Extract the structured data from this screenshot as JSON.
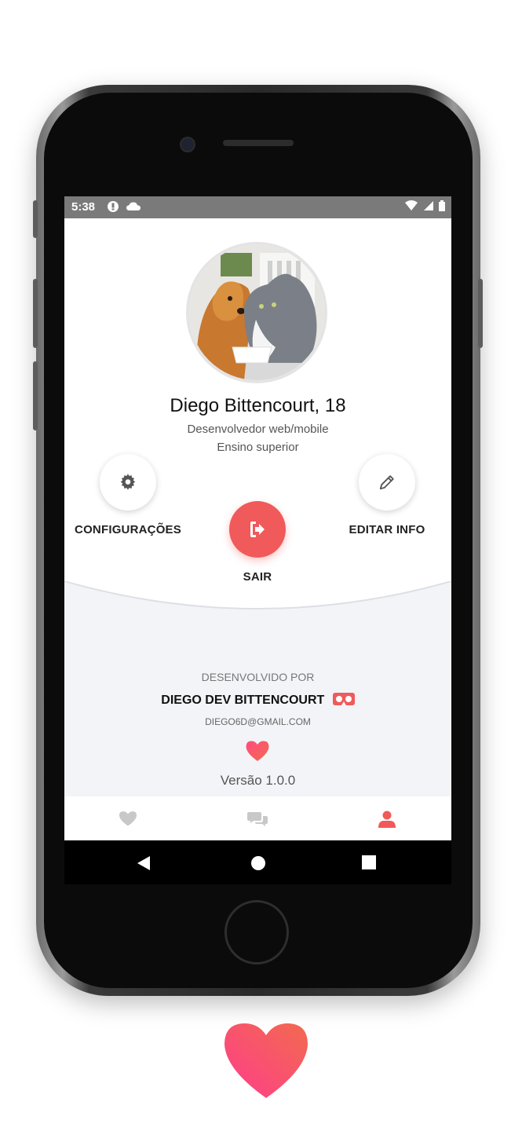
{
  "status_bar": {
    "time": "5:38",
    "left_icons": [
      "alert-circle-icon",
      "cloud-icon"
    ],
    "right_icons": [
      "wifi-icon",
      "signal-icon",
      "battery-icon"
    ]
  },
  "profile": {
    "name": "Diego Bittencourt, 18",
    "role": "Desenvolvedor web/mobile",
    "education": "Ensino superior",
    "avatar_icon": "avatar-photo"
  },
  "actions": {
    "settings_label": "CONFIGURAÇÕES",
    "settings_icon": "gear-icon",
    "edit_label": "EDITAR INFO",
    "edit_icon": "pencil-icon",
    "logout_label": "SAIR",
    "logout_icon": "logout-icon"
  },
  "developer": {
    "label": "DESENVOLVIDO POR",
    "name": "DIEGO DEV BITTENCOURT",
    "email": "DIEGO6D@GMAIL.COM",
    "version": "Versão 1.0.0"
  },
  "tabs": [
    {
      "icon": "heart-icon",
      "active": false
    },
    {
      "icon": "chat-icon",
      "active": false
    },
    {
      "icon": "user-icon",
      "active": true
    }
  ],
  "android_nav": [
    "back-icon",
    "home-icon",
    "recents-icon"
  ],
  "colors": {
    "accent": "#f05a5a",
    "heart_gradient_start": "#ff4d7e",
    "heart_gradient_end": "#f26a4f",
    "inactive_icon": "#c8c8c8"
  }
}
